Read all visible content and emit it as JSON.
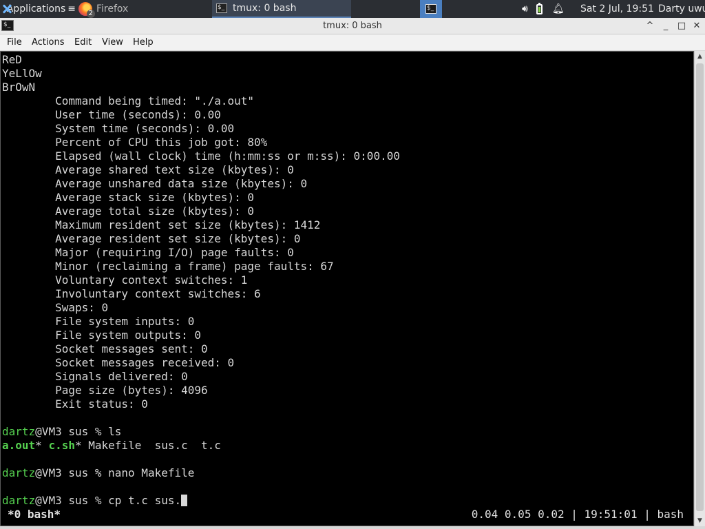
{
  "panel": {
    "applications_label": "Applications",
    "applications_suffix": "≡",
    "firefox_label": "Firefox",
    "firefox_badge": "2",
    "tmux_task_label": "tmux: 0 bash",
    "clock": "Sat  2 Jul, 19:51",
    "user": "Darty uwu"
  },
  "window": {
    "title": "tmux: 0 bash",
    "minimize": "_",
    "maximize": "□",
    "close": "✕",
    "rollup": "^"
  },
  "menubar": {
    "file": "File",
    "actions": "Actions",
    "edit": "Edit",
    "view": "View",
    "help": "Help"
  },
  "terminal": {
    "lines": [
      "ReD",
      "YeLlOw",
      "BrOwN",
      "        Command being timed: \"./a.out\"",
      "        User time (seconds): 0.00",
      "        System time (seconds): 0.00",
      "        Percent of CPU this job got: 80%",
      "        Elapsed (wall clock) time (h:mm:ss or m:ss): 0:00.00",
      "        Average shared text size (kbytes): 0",
      "        Average unshared data size (kbytes): 0",
      "        Average stack size (kbytes): 0",
      "        Average total size (kbytes): 0",
      "        Maximum resident set size (kbytes): 1412",
      "        Average resident set size (kbytes): 0",
      "        Major (requiring I/O) page faults: 0",
      "        Minor (reclaiming a frame) page faults: 67",
      "        Voluntary context switches: 1",
      "        Involuntary context switches: 6",
      "        Swaps: 0",
      "        File system inputs: 0",
      "        File system outputs: 0",
      "        Socket messages sent: 0",
      "        Socket messages received: 0",
      "        Signals delivered: 0",
      "        Page size (bytes): 4096",
      "        Exit status: 0",
      ""
    ],
    "prompt_user": "dartz",
    "prompt_rest": "@VM3 sus % ",
    "cmd1": "ls",
    "ls_items": [
      {
        "name": "a.out",
        "suffix": "*",
        "style": "gb"
      },
      {
        "name": "c.sh",
        "suffix": "*",
        "style": "gb"
      },
      {
        "name": "Makefile",
        "suffix": "",
        "style": ""
      },
      {
        "name": "sus.c",
        "suffix": "",
        "style": ""
      },
      {
        "name": "t.c",
        "suffix": "",
        "style": ""
      }
    ],
    "cmd2": "nano Makefile",
    "cmd3": "cp t.c sus."
  },
  "status": {
    "left": "*0 bash*",
    "right": "0.04 0.05 0.02 | 19:51:01 | bash"
  },
  "colors": {
    "prompt_green": "#55d04f",
    "panel_bg": "#2b2e33",
    "workspace_blue": "#4a7fc0"
  }
}
